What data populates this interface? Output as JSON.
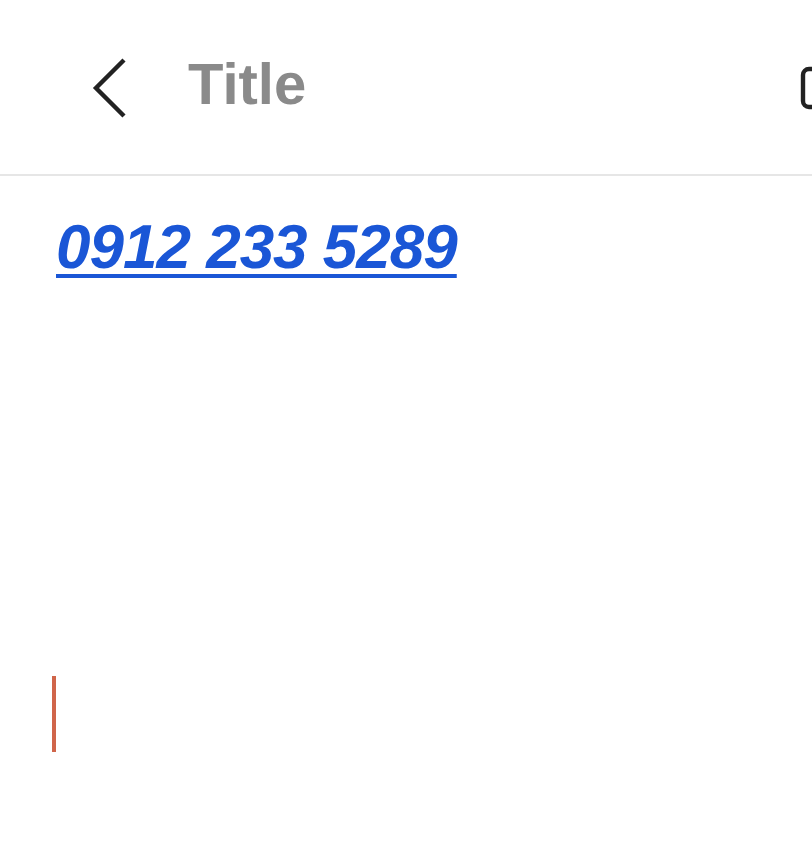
{
  "header": {
    "title": "Title"
  },
  "editor": {
    "phone_link": "0912 233 5289"
  }
}
